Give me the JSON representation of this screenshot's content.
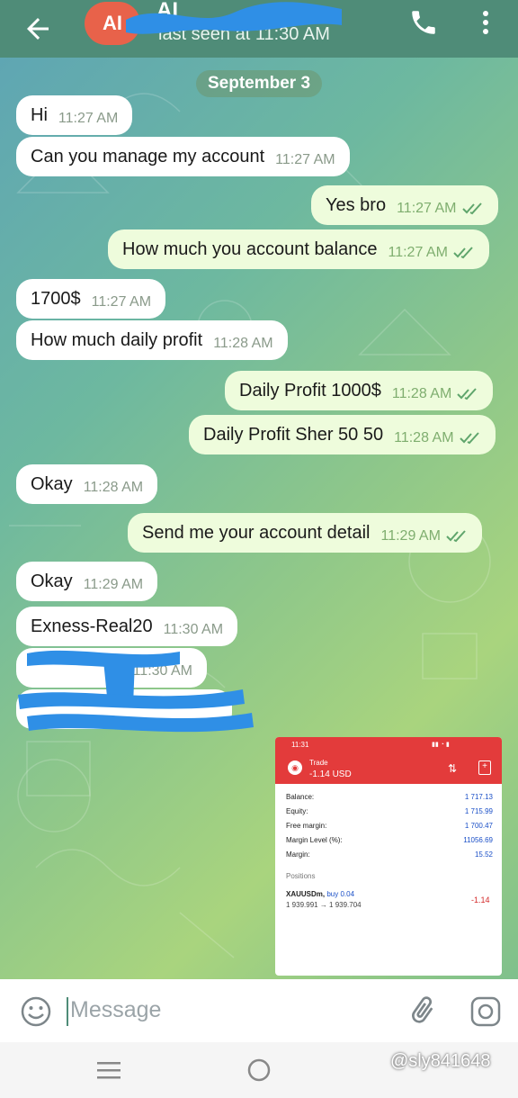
{
  "header": {
    "avatar_initials": "AI",
    "contact_name": "AI",
    "last_seen": "last seen at 11:30 AM"
  },
  "chat": {
    "date_label": "September 3",
    "messages": [
      {
        "dir": "in",
        "text": "Hi",
        "time": "11:27 AM"
      },
      {
        "dir": "in",
        "text": "Can you manage my account",
        "time": "11:27 AM"
      },
      {
        "dir": "out",
        "text": "Yes bro",
        "time": "11:27 AM"
      },
      {
        "dir": "out",
        "text": "How much you account balance",
        "time": "11:27 AM"
      },
      {
        "dir": "in",
        "text": "1700$",
        "time": "11:27 AM"
      },
      {
        "dir": "in",
        "text": "How much daily profit",
        "time": "11:28 AM"
      },
      {
        "dir": "out",
        "text": "Daily Profit 1000$",
        "time": "11:28 AM"
      },
      {
        "dir": "out",
        "text": "Daily Profit Sher 50 50",
        "time": "11:28 AM"
      },
      {
        "dir": "in",
        "text": "Okay",
        "time": "11:28 AM"
      },
      {
        "dir": "out",
        "text": "Send me your account detail",
        "time": "11:29 AM"
      },
      {
        "dir": "in",
        "text": "Okay",
        "time": "11:29 AM"
      },
      {
        "dir": "in",
        "text": "Exness-Real20",
        "time": "11:30 AM"
      },
      {
        "dir": "in",
        "text": "",
        "time": "11:30 AM"
      }
    ]
  },
  "trade_screenshot": {
    "status_time": "11:31",
    "title": "Trade",
    "profit": "-1.14 USD",
    "rows": [
      {
        "label": "Balance:",
        "value": "1 717.13"
      },
      {
        "label": "Equity:",
        "value": "1 715.99"
      },
      {
        "label": "Free margin:",
        "value": "1 700.47"
      },
      {
        "label": "Margin Level (%):",
        "value": "11056.69"
      },
      {
        "label": "Margin:",
        "value": "15.52"
      }
    ],
    "positions_label": "Positions",
    "symbol": "XAUUSDm,",
    "side": "buy 0.04",
    "prices": "1 939.991 → 1 939.704",
    "pnl": "-1.14"
  },
  "input": {
    "placeholder": "Message"
  },
  "watermark": "@sly841648",
  "colors": {
    "header": "#4f8c78",
    "incoming_bubble": "#ffffff",
    "outgoing_bubble": "#eefcdc",
    "check_marks": "#5fa56c",
    "trade_header": "#e33b3b"
  },
  "icons": [
    "back-arrow-icon",
    "phone-icon",
    "more-vert-icon",
    "emoji-icon",
    "attach-icon",
    "camera-icon",
    "nav-menu-icon",
    "nav-home-icon"
  ]
}
